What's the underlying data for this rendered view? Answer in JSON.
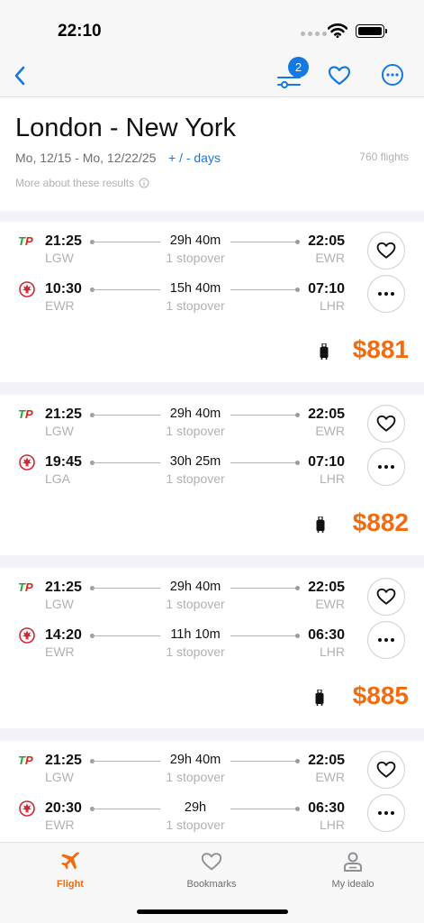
{
  "status": {
    "time": "22:10"
  },
  "nav": {
    "filter_count": "2",
    "back_icon": "chevron-left-icon",
    "heart_icon": "heart-icon",
    "more_icon": "more-icon"
  },
  "header": {
    "title": "London - New York",
    "dates": "Mo, 12/15 - Mo, 12/22/25",
    "days_link": "+ / - days",
    "count": "760 flights",
    "about": "More about these results"
  },
  "colors": {
    "accent": "#1479e0",
    "price": "#f26b0f",
    "tap": "#e2231a",
    "aircanada": "#d22630"
  },
  "results": [
    {
      "outbound": {
        "airline": "TAP",
        "dep_time": "21:25",
        "dep_code": "LGW",
        "duration": "29h 40m",
        "stops": "1 stopover",
        "arr_time": "22:05",
        "arr_code": "EWR"
      },
      "inbound": {
        "airline": "Air Canada",
        "dep_time": "10:30",
        "dep_code": "EWR",
        "duration": "15h 40m",
        "stops": "1 stopover",
        "arr_time": "07:10",
        "arr_code": "LHR"
      },
      "price": "$881"
    },
    {
      "outbound": {
        "airline": "TAP",
        "dep_time": "21:25",
        "dep_code": "LGW",
        "duration": "29h 40m",
        "stops": "1 stopover",
        "arr_time": "22:05",
        "arr_code": "EWR"
      },
      "inbound": {
        "airline": "Air Canada",
        "dep_time": "19:45",
        "dep_code": "LGA",
        "duration": "30h 25m",
        "stops": "1 stopover",
        "arr_time": "07:10",
        "arr_code": "LHR"
      },
      "price": "$882"
    },
    {
      "outbound": {
        "airline": "TAP",
        "dep_time": "21:25",
        "dep_code": "LGW",
        "duration": "29h 40m",
        "stops": "1 stopover",
        "arr_time": "22:05",
        "arr_code": "EWR"
      },
      "inbound": {
        "airline": "Air Canada",
        "dep_time": "14:20",
        "dep_code": "EWR",
        "duration": "11h 10m",
        "stops": "1 stopover",
        "arr_time": "06:30",
        "arr_code": "LHR"
      },
      "price": "$885"
    },
    {
      "outbound": {
        "airline": "TAP",
        "dep_time": "21:25",
        "dep_code": "LGW",
        "duration": "29h 40m",
        "stops": "1 stopover",
        "arr_time": "22:05",
        "arr_code": "EWR"
      },
      "inbound": {
        "airline": "Air Canada",
        "dep_time": "20:30",
        "dep_code": "EWR",
        "duration": "29h",
        "stops": "1 stopover",
        "arr_time": "06:30",
        "arr_code": "LHR"
      },
      "price": ""
    }
  ],
  "tabs": [
    {
      "label": "Flight",
      "icon": "airplane-icon",
      "active": true
    },
    {
      "label": "Bookmarks",
      "icon": "heart-icon",
      "active": false
    },
    {
      "label": "My idealo",
      "icon": "person-icon",
      "active": false
    }
  ]
}
